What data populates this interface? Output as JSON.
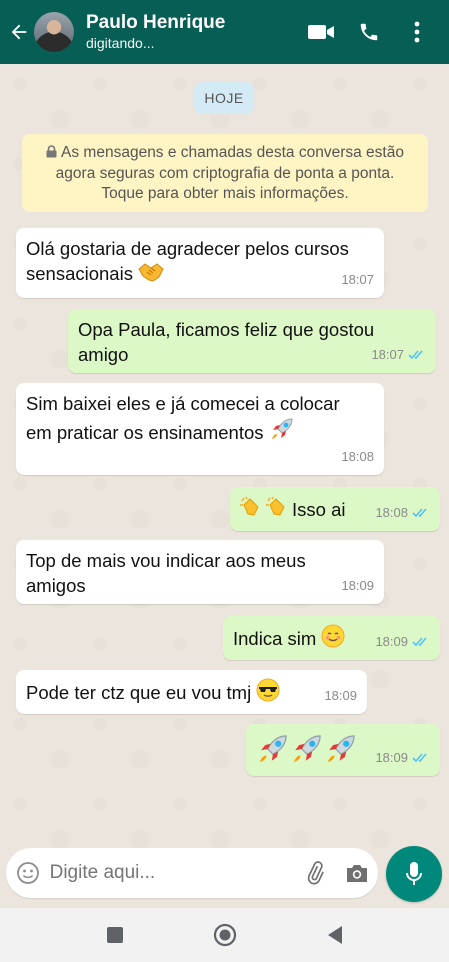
{
  "header": {
    "contact_name": "Paulo Henrique",
    "status": "digitando...",
    "bg_color": "#075e54"
  },
  "chat": {
    "date_label": "HOJE",
    "encryption_notice": "As mensagens e chamadas desta conversa estão agora seguras com criptografia de ponta a ponta. Toque para obter mais informações.",
    "messages": [
      {
        "direction": "in",
        "text": "Olá gostaria de agradecer pelos cursos sensacionais",
        "emoji": "handshake",
        "time": "18:07"
      },
      {
        "direction": "out",
        "text": "Opa Paula, ficamos feliz que gostou amigo",
        "time": "18:07",
        "read": true
      },
      {
        "direction": "in",
        "text": "Sim baixei eles e já comecei a colocar em praticar os ensinamentos",
        "emoji": "rocket",
        "time": "18:08"
      },
      {
        "direction": "out",
        "text": "Isso ai",
        "emoji": "clapping-hands x2",
        "time": "18:08",
        "read": true
      },
      {
        "direction": "in",
        "text": "Top de mais vou indicar aos meus amigos",
        "time": "18:09"
      },
      {
        "direction": "out",
        "text": "Indica sim",
        "emoji": "smiling-face",
        "time": "18:09",
        "read": true
      },
      {
        "direction": "in",
        "text": "Pode ter ctz que eu vou tmj",
        "emoji": "sunglasses-face",
        "time": "18:09"
      },
      {
        "direction": "out",
        "text": "",
        "emoji": "rocket x3",
        "time": "18:09",
        "read": true
      }
    ]
  },
  "composer": {
    "placeholder": "Digite aqui..."
  },
  "colors": {
    "incoming_bubble": "#ffffff",
    "outgoing_bubble": "#dcf8c6",
    "read_ticks": "#4fc3f7",
    "mic_button": "#00897b"
  }
}
